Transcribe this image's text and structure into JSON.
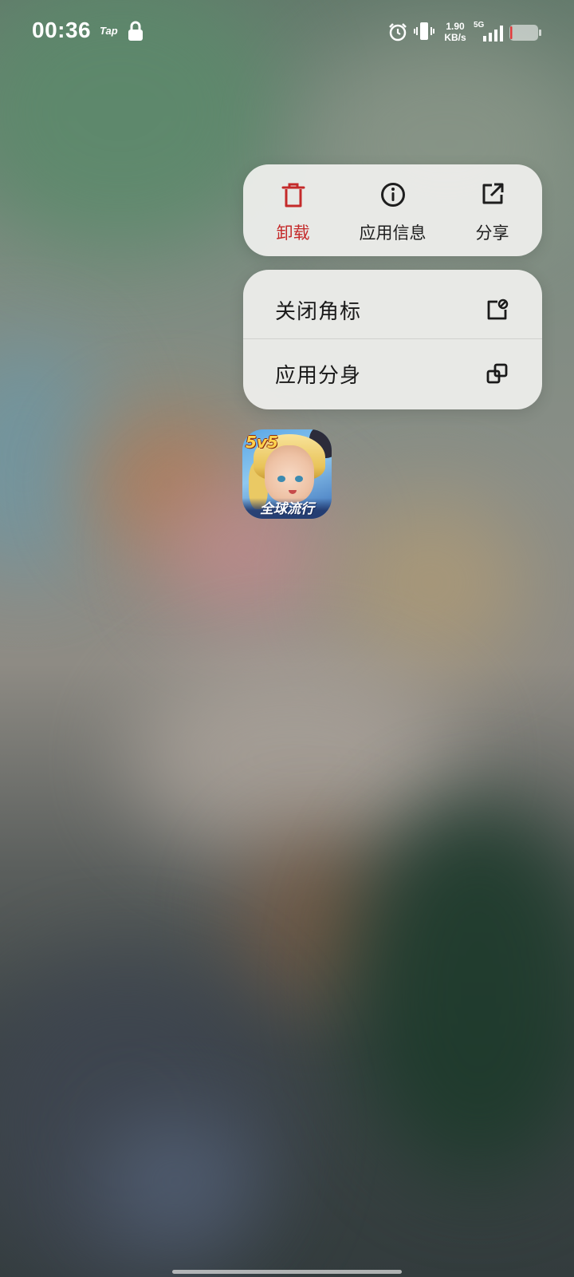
{
  "status_bar": {
    "time": "00:36",
    "tap_label": "Tap",
    "net_speed_value": "1.90",
    "net_speed_unit": "KB/s",
    "network_type": "5G",
    "battery_level_fraction": 0.05,
    "icons": [
      "lock-icon",
      "alarm-icon",
      "vibrate-icon",
      "signal-icon",
      "battery-icon"
    ]
  },
  "quick_actions": {
    "uninstall_label": "卸载",
    "app_info_label": "应用信息",
    "share_label": "分享",
    "uninstall_color": "#c42a2a"
  },
  "menu": {
    "items": [
      {
        "label": "关闭角标",
        "icon": "badge-off-icon"
      },
      {
        "label": "应用分身",
        "icon": "app-clone-icon"
      }
    ]
  },
  "app_icon": {
    "badge_top": "5v5",
    "badge_bottom": "全球流行"
  }
}
